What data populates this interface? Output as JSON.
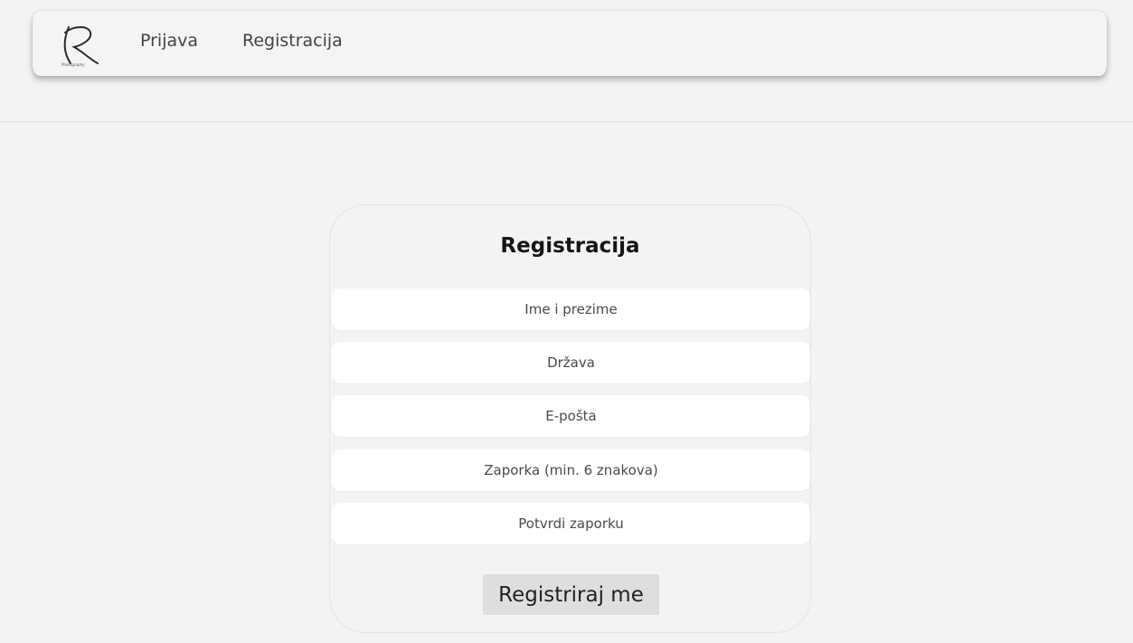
{
  "nav": {
    "logo_icon": "signature-r-logo-icon",
    "logo_text": "Photography",
    "links": [
      {
        "label": "Prijava"
      },
      {
        "label": "Registracija"
      }
    ]
  },
  "form": {
    "title": "Registracija",
    "fields": [
      {
        "placeholder": "Ime i prezime",
        "value": ""
      },
      {
        "placeholder": "Država",
        "value": ""
      },
      {
        "placeholder": "E-pošta",
        "value": ""
      },
      {
        "placeholder": "Zaporka (min. 6 znakova)",
        "value": ""
      },
      {
        "placeholder": "Potvrdi zaporku",
        "value": ""
      }
    ],
    "submit_label": "Registriraj me"
  },
  "colors": {
    "background": "#f3f3f3",
    "card_border": "#e3e3e3",
    "field_background": "#ffffff",
    "button_background": "#dedede"
  }
}
